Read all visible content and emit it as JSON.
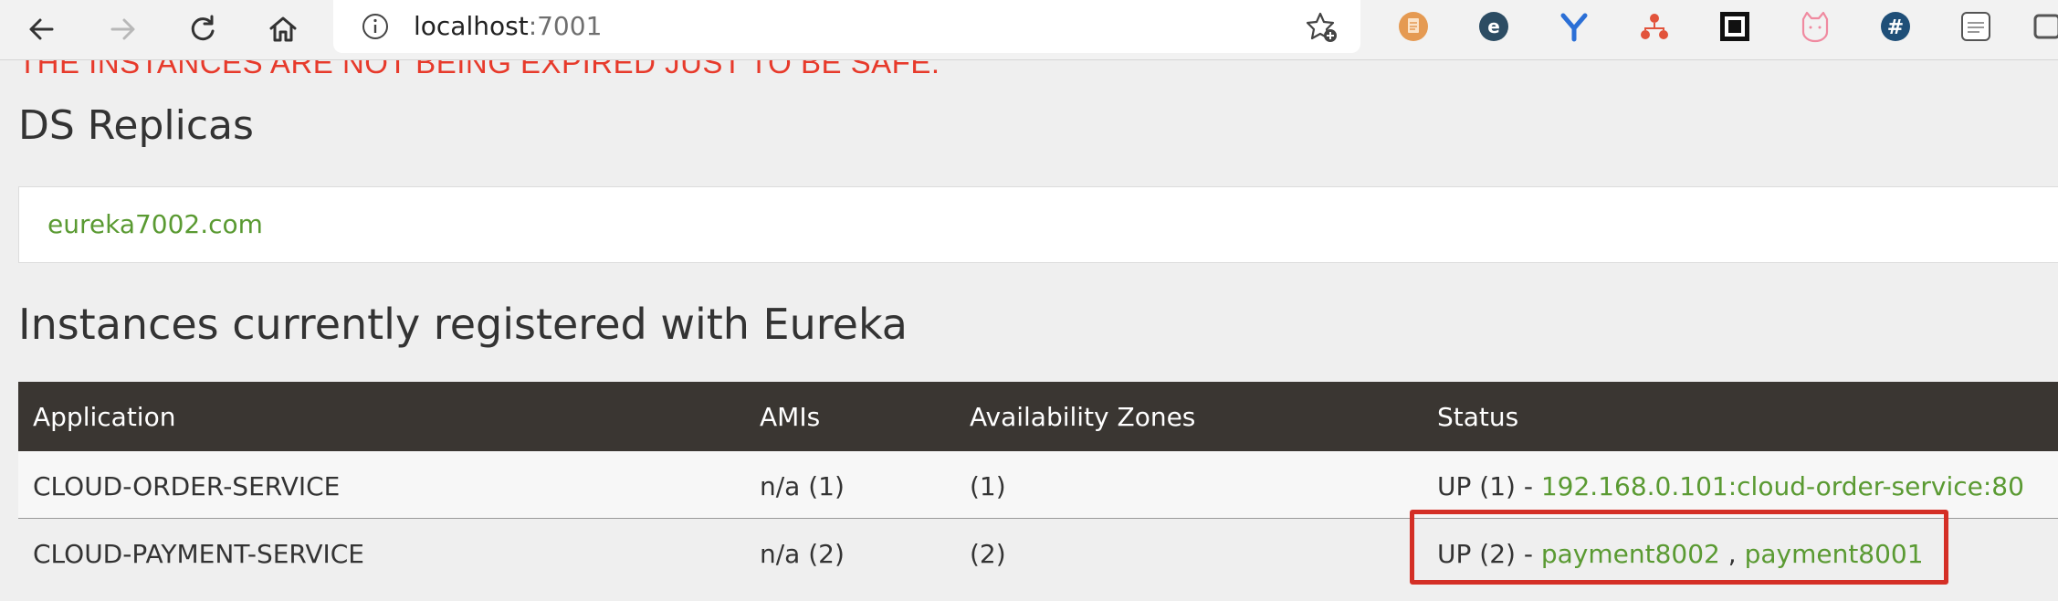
{
  "browser": {
    "url_host": "localhost",
    "url_port": ":7001",
    "nav": {
      "back": "back-arrow-icon",
      "forward": "forward-arrow-icon",
      "reload": "reload-icon",
      "home": "home-icon"
    },
    "extensions": [
      {
        "name": "notes-extension-icon",
        "color": "#e59a52"
      },
      {
        "name": "e-extension-icon",
        "color": "#2c4c63"
      },
      {
        "name": "y-extension-icon",
        "color": "#2b6fd6"
      },
      {
        "name": "sitemap-extension-icon",
        "color": "#e2533b"
      },
      {
        "name": "qr-extension-icon",
        "color": "#111111"
      },
      {
        "name": "cat-extension-icon",
        "color": "#f08aa0"
      },
      {
        "name": "hash-extension-icon",
        "color": "#1f4f78"
      },
      {
        "name": "json-extension-icon",
        "color": "#555555"
      }
    ]
  },
  "page": {
    "warning": "THE INSTANCES ARE NOT BEING EXPIRED JUST TO BE SAFE.",
    "replicas_heading": "DS Replicas",
    "replica": "eureka7002.com",
    "instances_heading": "Instances currently registered with Eureka"
  },
  "table": {
    "headers": {
      "application": "Application",
      "amis": "AMIs",
      "zones": "Availability Zones",
      "status": "Status"
    },
    "rows": [
      {
        "application": "CLOUD-ORDER-SERVICE",
        "amis": "n/a (1)",
        "zones": "(1)",
        "status_prefix": "UP (1) - ",
        "links": [
          "192.168.0.101:cloud-order-service:80"
        ],
        "sep": ""
      },
      {
        "application": "CLOUD-PAYMENT-SERVICE",
        "amis": "n/a (2)",
        "zones": "(2)",
        "status_prefix": "UP (2) - ",
        "links": [
          "payment8002",
          "payment8001"
        ],
        "sep": " , "
      }
    ]
  },
  "colors": {
    "warning": "#e73a2b",
    "link": "#5a9a32",
    "header_bg": "#3a3632",
    "highlight": "#d42f26"
  }
}
